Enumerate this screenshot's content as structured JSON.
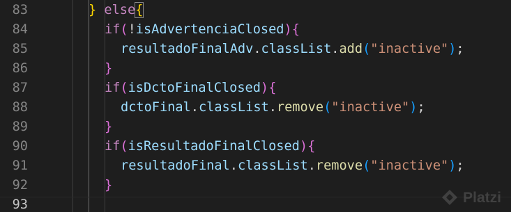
{
  "editor": {
    "lines": [
      {
        "num": "83",
        "current": false,
        "indent": 0,
        "tokens": [
          {
            "t": "} ",
            "c": "b3"
          },
          {
            "t": "else",
            "c": "k"
          },
          {
            "t": "{",
            "c": "b3",
            "box": true
          }
        ]
      },
      {
        "num": "84",
        "current": false,
        "indent": 1,
        "tokens": [
          {
            "t": "if",
            "c": "k"
          },
          {
            "t": "(",
            "c": "b1"
          },
          {
            "t": "!",
            "c": "p"
          },
          {
            "t": "isAdvertenciaClosed",
            "c": "v"
          },
          {
            "t": ")",
            "c": "b1"
          },
          {
            "t": "{",
            "c": "b1"
          }
        ]
      },
      {
        "num": "85",
        "current": false,
        "indent": 2,
        "tokens": [
          {
            "t": "resultadoFinalAdv",
            "c": "v"
          },
          {
            "t": ".",
            "c": "p"
          },
          {
            "t": "classList",
            "c": "v"
          },
          {
            "t": ".",
            "c": "p"
          },
          {
            "t": "add",
            "c": "fn"
          },
          {
            "t": "(",
            "c": "b2"
          },
          {
            "t": "\"inactive\"",
            "c": "s"
          },
          {
            "t": ")",
            "c": "b2"
          },
          {
            "t": ";",
            "c": "p"
          }
        ]
      },
      {
        "num": "86",
        "current": false,
        "indent": 1,
        "tokens": [
          {
            "t": "}",
            "c": "b1"
          }
        ]
      },
      {
        "num": "87",
        "current": false,
        "indent": 1,
        "tokens": [
          {
            "t": "if",
            "c": "k"
          },
          {
            "t": "(",
            "c": "b1"
          },
          {
            "t": "isDctoFinalClosed",
            "c": "v"
          },
          {
            "t": ")",
            "c": "b1"
          },
          {
            "t": "{",
            "c": "b1"
          }
        ]
      },
      {
        "num": "88",
        "current": false,
        "indent": 2,
        "tokens": [
          {
            "t": "dctoFinal",
            "c": "v"
          },
          {
            "t": ".",
            "c": "p"
          },
          {
            "t": "classList",
            "c": "v"
          },
          {
            "t": ".",
            "c": "p"
          },
          {
            "t": "remove",
            "c": "fn"
          },
          {
            "t": "(",
            "c": "b2"
          },
          {
            "t": "\"inactive\"",
            "c": "s"
          },
          {
            "t": ")",
            "c": "b2"
          },
          {
            "t": ";",
            "c": "p"
          }
        ]
      },
      {
        "num": "89",
        "current": false,
        "indent": 1,
        "tokens": [
          {
            "t": "}",
            "c": "b1"
          }
        ]
      },
      {
        "num": "90",
        "current": false,
        "indent": 1,
        "tokens": [
          {
            "t": "if",
            "c": "k"
          },
          {
            "t": "(",
            "c": "b1"
          },
          {
            "t": "isResultadoFinalClosed",
            "c": "v"
          },
          {
            "t": ")",
            "c": "b1"
          },
          {
            "t": "{",
            "c": "b1"
          }
        ]
      },
      {
        "num": "91",
        "current": false,
        "indent": 2,
        "tokens": [
          {
            "t": "resultadoFinal",
            "c": "v"
          },
          {
            "t": ".",
            "c": "p"
          },
          {
            "t": "classList",
            "c": "v"
          },
          {
            "t": ".",
            "c": "p"
          },
          {
            "t": "remove",
            "c": "fn"
          },
          {
            "t": "(",
            "c": "b2"
          },
          {
            "t": "\"inactive\"",
            "c": "s"
          },
          {
            "t": ")",
            "c": "b2"
          },
          {
            "t": ";",
            "c": "p"
          }
        ]
      },
      {
        "num": "92",
        "current": false,
        "indent": 1,
        "tokens": [
          {
            "t": "}",
            "c": "b1"
          }
        ]
      },
      {
        "num": "93",
        "current": true,
        "indent": 0,
        "tokens": []
      }
    ]
  },
  "watermark": {
    "text": "Platzi",
    "icon": "platzi-logo-icon"
  },
  "colors": {
    "background": "#1e1e1e",
    "line_number": "#858585",
    "keyword": "#c586c0",
    "function": "#dcdcaa",
    "variable": "#9cdcfe",
    "string": "#ce9178",
    "bracket_level1": "#da70d6",
    "bracket_level2": "#179fff",
    "bracket_level3": "#ffd700"
  }
}
